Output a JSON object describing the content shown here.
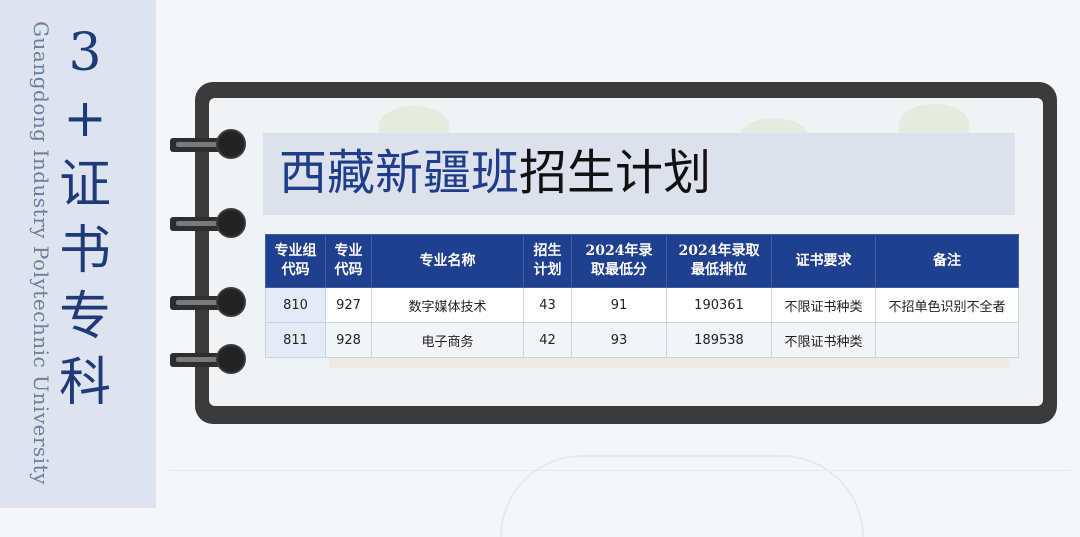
{
  "side_banner": {
    "chinese_chars": [
      "3",
      "+",
      "证",
      "书",
      "专",
      "科"
    ],
    "english": "Guangdong Industry Polytechnic University"
  },
  "title": {
    "blue_part": "西藏新疆班",
    "black_part": "招生计划"
  },
  "table": {
    "headers": [
      [
        "专业组",
        "代码"
      ],
      [
        "专业",
        "代码"
      ],
      [
        "专业名称"
      ],
      [
        "招生",
        "计划"
      ],
      [
        "2024年录",
        "取最低分"
      ],
      [
        "2024年录取",
        "最低排位"
      ],
      [
        "证书要求"
      ],
      [
        "备注"
      ]
    ],
    "rows": [
      [
        "810",
        "927",
        "数字媒体技术",
        "43",
        "91",
        "190361",
        "不限证书种类",
        "不招单色识别不全者"
      ],
      [
        "811",
        "928",
        "电子商务",
        "42",
        "93",
        "189538",
        "不限证书种类",
        ""
      ]
    ]
  },
  "colors": {
    "header_blue": "#1f3f8f",
    "title_blue": "#1f3d8a",
    "banner_bg": "#dde4f0",
    "board": "#3b3b3b"
  }
}
